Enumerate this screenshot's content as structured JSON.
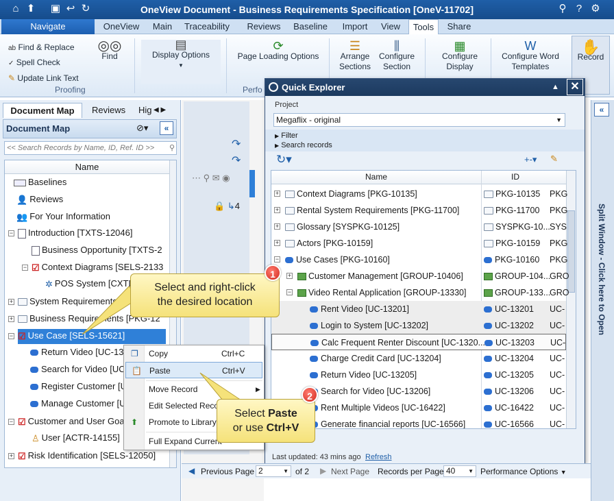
{
  "window": {
    "title": "OneView Document - Business Requirements Specification [OneV-11702]"
  },
  "tabs": [
    "Navigate",
    "OneView",
    "Main",
    "Traceability",
    "Reviews",
    "Baseline",
    "Import",
    "View",
    "Tools",
    "Share"
  ],
  "active_tab": "Tools",
  "ribbon": {
    "find_replace": "Find & Replace",
    "spell_check": "Spell Check",
    "update_link_text": "Update Link Text",
    "find": "Find",
    "proofing": "Proofing",
    "display_options": "Display Options",
    "page_loading_options": "Page Loading Options",
    "perf_label": "Perfo",
    "arrange_sections_1": "Arrange",
    "arrange_sections_2": "Sections",
    "configure_section_1": "Configure",
    "configure_section_2": "Section",
    "configure_display_1": "Configure",
    "configure_display_2": "Display",
    "configure_word_1": "Configure Word",
    "configure_word_2": "Templates",
    "record": "Record"
  },
  "left_panel": {
    "tabs": [
      "Document Map",
      "Reviews",
      "Hig"
    ],
    "header": "Document Map",
    "search_placeholder": "<< Search Records by Name, ID, Ref. ID >>",
    "column": "Name",
    "items": [
      "Baselines",
      "Reviews",
      "For Your Information",
      "Introduction [TXTS-12046]",
      "Business Opportunity [TXTS-2",
      "Context Diagrams [SELS-2133",
      "POS System [CXTD",
      "System Requirements",
      "Business Requirements [PKG-12",
      "Use Case [SELS-15621]",
      "Return Video [UC-132",
      "Search for Video [UC-",
      "Register Customer [U",
      "Manage Customer [U",
      "Customer and User Goa",
      "User [ACTR-14155]",
      "Risk Identification [SELS-12050]"
    ]
  },
  "mid": {
    "count": "4"
  },
  "context_menu": {
    "items": [
      {
        "label": "Copy",
        "shortcut": "Ctrl+C"
      },
      {
        "label": "Paste",
        "shortcut": "Ctrl+V"
      },
      {
        "label": "Move Record",
        "shortcut": ""
      },
      {
        "label": "Edit Selected Recor",
        "shortcut": ""
      },
      {
        "label": "Promote to Library",
        "shortcut": ""
      },
      {
        "label": "Full Expand Current",
        "shortcut": ""
      }
    ]
  },
  "callouts": {
    "one_line1": "Select and right-click",
    "one_line2": "the desired location",
    "two_pre": "Select ",
    "two_bold1": "Paste",
    "two_mid": "or use ",
    "two_bold2": "Ctrl+V",
    "badge1": "1",
    "badge2": "2"
  },
  "quick_explorer": {
    "title": "Quick Explorer",
    "project_label": "Project",
    "project_value": "Megaflix - original",
    "filter": "Filter",
    "search_records": "Search records",
    "col_name": "Name",
    "col_id": "ID",
    "rows": [
      {
        "name": "Context Diagrams [PKG-10135]",
        "id": "PKG-10135",
        "extra": "PKG"
      },
      {
        "name": "Rental System Requirements [PKG-11700]",
        "id": "PKG-11700",
        "extra": "PKG"
      },
      {
        "name": "Glossary [SYSPKG-10125]",
        "id": "SYSPKG-10...",
        "extra": "SYS"
      },
      {
        "name": "Actors [PKG-10159]",
        "id": "PKG-10159",
        "extra": "PKG"
      },
      {
        "name": "Use Cases [PKG-10160]",
        "id": "PKG-10160",
        "extra": "PKG"
      },
      {
        "name": "Customer Management [GROUP-10406]",
        "id": "GROUP-104...",
        "extra": "GRO"
      },
      {
        "name": "Video Rental Application [GROUP-13330]",
        "id": "GROUP-133...",
        "extra": "GRO"
      },
      {
        "name": "Rent Video [UC-13201]",
        "id": "UC-13201",
        "extra": "UC-"
      },
      {
        "name": "Login to System [UC-13202]",
        "id": "UC-13202",
        "extra": "UC-"
      },
      {
        "name": "Calc Frequent Renter Discount [UC-1320...",
        "id": "UC-13203",
        "extra": "UC-"
      },
      {
        "name": "Charge Credit Card [UC-13204]",
        "id": "UC-13204",
        "extra": "UC-"
      },
      {
        "name": "Return Video [UC-13205]",
        "id": "UC-13205",
        "extra": "UC-"
      },
      {
        "name": "Search for Video [UC-13206]",
        "id": "UC-13206",
        "extra": "UC-"
      },
      {
        "name": "Rent Multiple Videos [UC-16422]",
        "id": "UC-16422",
        "extra": "UC-"
      },
      {
        "name": "Generate financial reports [UC-16566]",
        "id": "UC-16566",
        "extra": "UC-"
      },
      {
        "name": "thers [GROUP-21421]",
        "id": "GROUP-214...",
        "extra": "GRO"
      }
    ],
    "last_updated": "Last updated: 43 mins ago",
    "refresh": "Refresh"
  },
  "bottom": {
    "previous_page": "Previous Page",
    "page_value": "2",
    "of_pages": "of 2",
    "next_page": "Next Page",
    "records_per_page": "Records per Page",
    "rpp_value": "40",
    "performance_options": "Performance Options"
  },
  "right_strip": {
    "text": "Split Window - Click here to Open"
  },
  "colors": {
    "title_bar": "#1f5fa8",
    "navigate_tab": "#2f78cf",
    "qe_title": "#1c3a5f",
    "callout": "#f5e27a",
    "badge": "#d22a1f"
  }
}
